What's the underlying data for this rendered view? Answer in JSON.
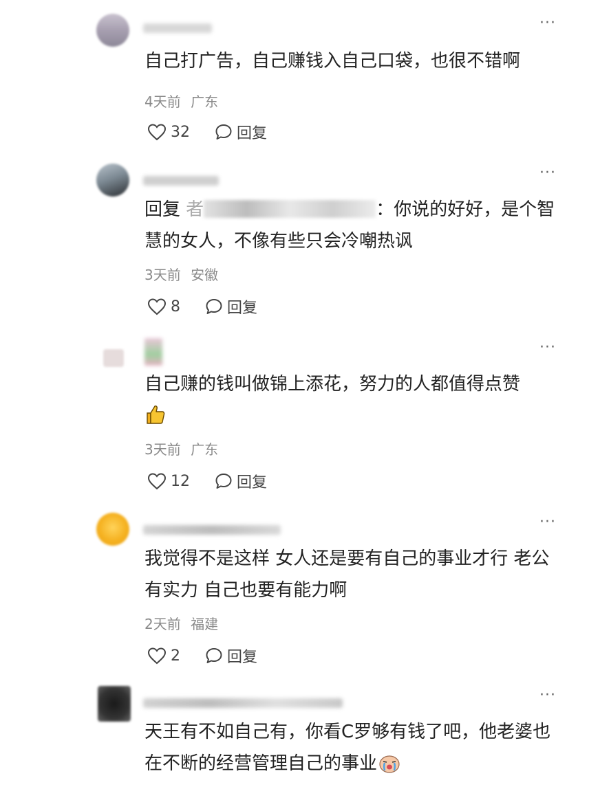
{
  "comments": [
    {
      "text": "自己打广告，自己赚钱入自己口袋，也很不错啊",
      "time": "4天前",
      "location": "广东",
      "likes": "32",
      "reply_label": "回复"
    },
    {
      "reply_prefix": "回复",
      "reply_to_initial": "者",
      "text": "：你说的好好，是个智慧的女人，不像有些只会冷嘲热讽",
      "time": "3天前",
      "location": "安徽",
      "likes": "8",
      "reply_label": "回复"
    },
    {
      "text": "自己赚的钱叫做锦上添花，努力的人都值得点赞",
      "emoji": "thumbs-up-icon",
      "time": "3天前",
      "location": "广东",
      "likes": "12",
      "reply_label": "回复"
    },
    {
      "text": "我觉得不是这样 女人还是要有自己的事业才行 老公有实力 自己也要有能力啊",
      "time": "2天前",
      "location": "福建",
      "likes": "2",
      "reply_label": "回复"
    },
    {
      "text": "天王有不如自己有，你看C罗够有钱了吧，他老婆也在不断的经营管理自己的事业",
      "emoji": "crying-face-icon"
    }
  ],
  "more_label": "···"
}
